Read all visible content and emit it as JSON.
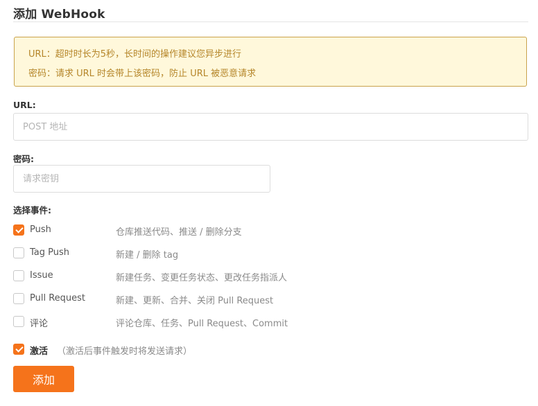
{
  "page": {
    "title": "添加 WebHook"
  },
  "notice": {
    "line1": "URL：超时时长为5秒，长时间的操作建议您异步进行",
    "line2": "密码：请求 URL 时会带上该密码，防止 URL 被恶意请求"
  },
  "url_field": {
    "label": "URL:",
    "value": "",
    "placeholder": "POST 地址"
  },
  "password_field": {
    "label": "密码:",
    "value": "",
    "placeholder": "请求密钥"
  },
  "events": {
    "label": "选择事件:",
    "items": [
      {
        "name": "Push",
        "description": "仓库推送代码、推送 / 删除分支",
        "checked": true
      },
      {
        "name": "Tag Push",
        "description": "新建 / 删除 tag",
        "checked": false
      },
      {
        "name": "Issue",
        "description": "新建任务、变更任务状态、更改任务指派人",
        "checked": false
      },
      {
        "name": "Pull Request",
        "description": "新建、更新、合并、关闭 Pull Request",
        "checked": false
      },
      {
        "name": "评论",
        "description": "评论仓库、任务、Pull Request、Commit",
        "checked": false
      }
    ]
  },
  "activate": {
    "label": "激活",
    "hint": "（激活后事件触发时将发送请求）",
    "checked": true
  },
  "submit": {
    "label": "添加"
  },
  "colors": {
    "accent": "#f5731b",
    "notice_bg": "#fff8db",
    "notice_border": "#c9a24b",
    "notice_text": "#b5862a"
  }
}
